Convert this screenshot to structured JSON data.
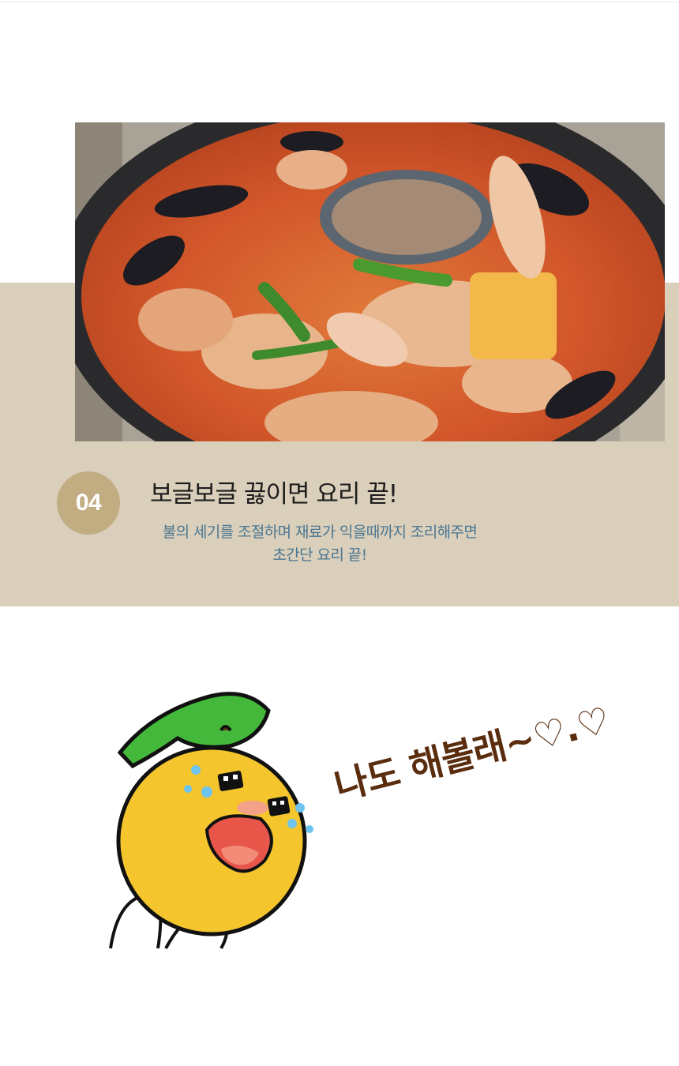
{
  "step": {
    "number": "04",
    "title": "보글보글 끓이면 요리 끝!",
    "description_lines": [
      "불의 세기를 조절하며  재료가 익을때까지 조리해주면",
      "초간단 요리 끝!"
    ]
  },
  "photo": {
    "subject": "spicy seafood stew with mussels, tofu, eggs and green chili in a black pot"
  },
  "mascot": {
    "speech": "나도 해볼래~♡.♡"
  },
  "colors": {
    "band": "#d9cfba",
    "badge": "#c2ac82",
    "description": "#4a7693",
    "speech": "#5a2d0f"
  }
}
